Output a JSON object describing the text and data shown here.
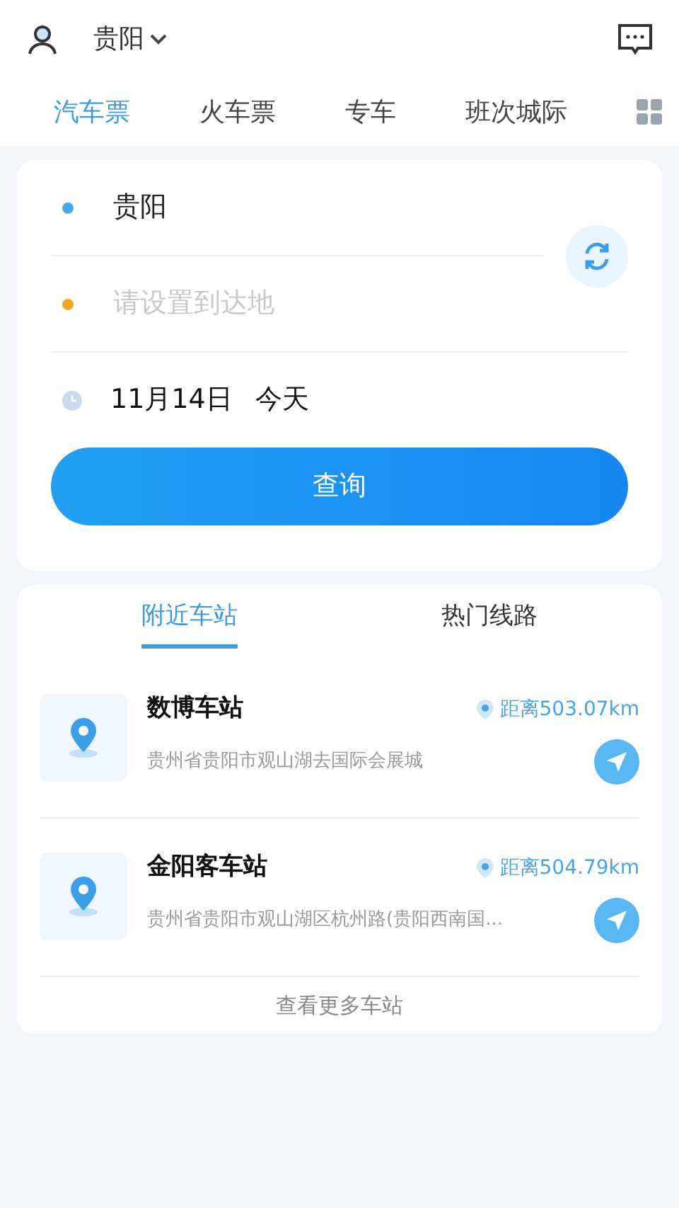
{
  "header": {
    "city": "贵阳"
  },
  "top_tabs": [
    {
      "label": "汽车票",
      "selected": true
    },
    {
      "label": "火车票",
      "selected": false
    },
    {
      "label": "专车",
      "selected": false
    },
    {
      "label": "班次城际",
      "selected": false
    }
  ],
  "search_form": {
    "origin": {
      "value": "贵阳"
    },
    "destination": {
      "placeholder": "请设置到达地"
    },
    "date": {
      "day": "11月14日",
      "relative": "今天"
    },
    "submit": "查询"
  },
  "station_tabs": [
    {
      "label": "附近车站",
      "selected": true
    },
    {
      "label": "热门线路",
      "selected": false
    }
  ],
  "stations": [
    {
      "name": "数博车站",
      "distance": "距离503.07km",
      "address": "贵州省贵阳市观山湖去国际会展城"
    },
    {
      "name": "金阳客车站",
      "distance": "距离504.79km",
      "address": "贵州省贵阳市观山湖区杭州路(贵阳西南国..."
    }
  ],
  "more_link": "查看更多车站"
}
